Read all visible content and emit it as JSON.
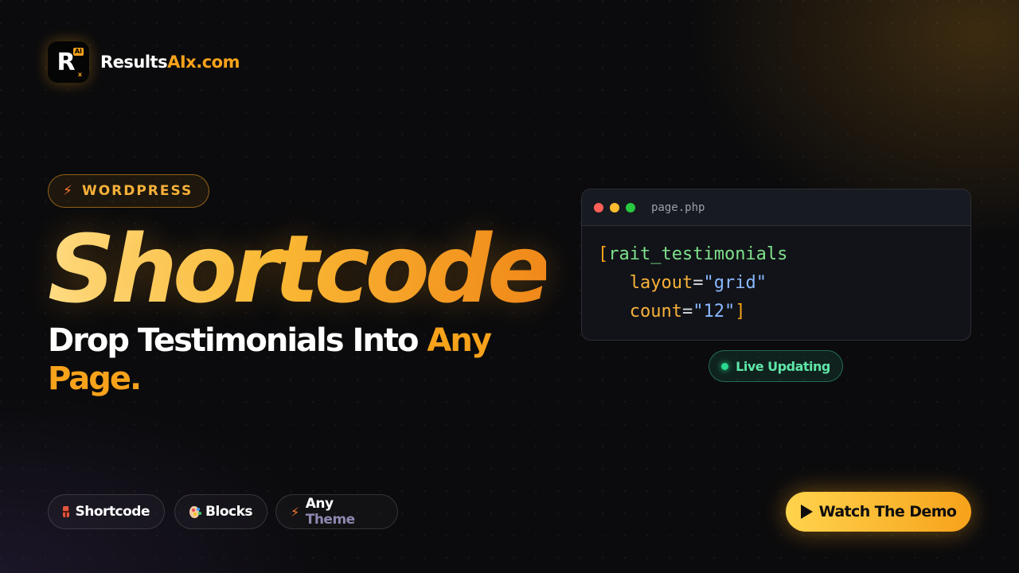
{
  "brand": {
    "logo_letter": "R",
    "logo_badge": "AI",
    "logo_sub": "x",
    "name_white": "Results",
    "name_orange": "AIx.com"
  },
  "tag": {
    "icon": "lightning-icon",
    "label": "WORDPRESS"
  },
  "headline": "Shortcode",
  "subhead": {
    "white": "Drop Testimonials Into ",
    "orange_1": "Any",
    "orange_2": "Page."
  },
  "code_window": {
    "filename": "page.php",
    "line1_bracket": "[",
    "line1_tag": "rait_testimonials",
    "line2_attr": "layout",
    "line2_eq": "=",
    "line2_val": "\"grid\"",
    "line3_attr": "count",
    "line3_eq": "=",
    "line3_val": "\"12\"",
    "line3_close": "]"
  },
  "live_badge": "Live Updating",
  "chips": [
    {
      "icon": "brick-icon",
      "label": "Shortcode"
    },
    {
      "icon": "palette-icon",
      "label": "Blocks"
    },
    {
      "icon": "lightning-icon",
      "label_white": "Any",
      "label_muted": "Theme"
    }
  ],
  "cta": {
    "icon": "play-icon",
    "label": "Watch The Demo"
  },
  "colors": {
    "accent": "#f7a21b",
    "background": "#0b0b0d",
    "live": "#2bd98f"
  }
}
